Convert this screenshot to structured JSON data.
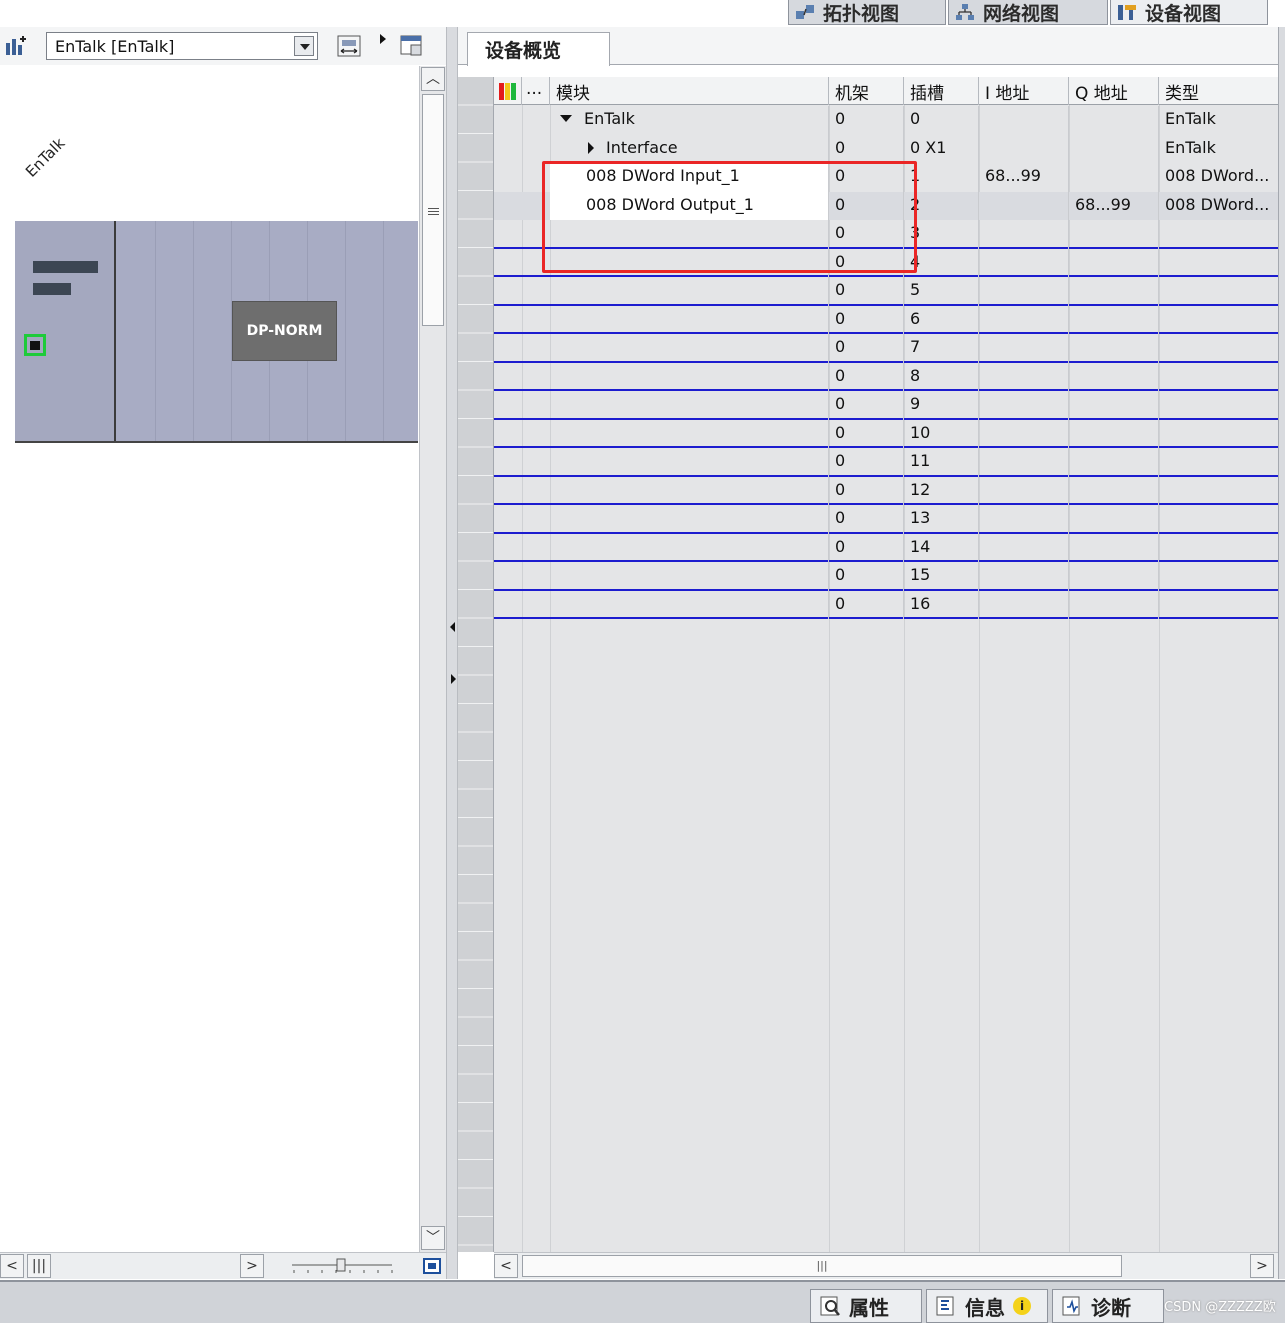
{
  "top_tabs": [
    {
      "label": "拓扑视图",
      "icon": "topology-view-icon"
    },
    {
      "label": "网络视图",
      "icon": "network-view-icon"
    },
    {
      "label": "设备视图",
      "icon": "device-view-icon",
      "active": true
    }
  ],
  "left": {
    "device_select_value": "EnTalk [EnTalk]",
    "rack_label": "EnTalk",
    "module_label": "DP-NORM"
  },
  "overview": {
    "tab_label": "设备概览",
    "columns": {
      "ellipsis": "...",
      "module": "模块",
      "rack": "机架",
      "slot": "插槽",
      "i_addr": "I 地址",
      "q_addr": "Q 地址",
      "type": "类型"
    },
    "rows": [
      {
        "module": "EnTalk",
        "rack": "0",
        "slot": "0",
        "i_addr": "",
        "q_addr": "",
        "type": "EnTalk"
      },
      {
        "module": "Interface",
        "rack": "0",
        "slot": "0 X1",
        "i_addr": "",
        "q_addr": "",
        "type": "EnTalk"
      },
      {
        "module": "008 DWord Input_1",
        "rack": "0",
        "slot": "1",
        "i_addr": "68...99",
        "q_addr": "",
        "type": "008 DWord..."
      },
      {
        "module": "008 DWord Output_1",
        "rack": "0",
        "slot": "2",
        "i_addr": "",
        "q_addr": "68...99",
        "type": "008 DWord..."
      },
      {
        "module": "",
        "rack": "0",
        "slot": "3",
        "i_addr": "",
        "q_addr": "",
        "type": ""
      },
      {
        "module": "",
        "rack": "0",
        "slot": "4",
        "i_addr": "",
        "q_addr": "",
        "type": ""
      },
      {
        "module": "",
        "rack": "0",
        "slot": "5",
        "i_addr": "",
        "q_addr": "",
        "type": ""
      },
      {
        "module": "",
        "rack": "0",
        "slot": "6",
        "i_addr": "",
        "q_addr": "",
        "type": ""
      },
      {
        "module": "",
        "rack": "0",
        "slot": "7",
        "i_addr": "",
        "q_addr": "",
        "type": ""
      },
      {
        "module": "",
        "rack": "0",
        "slot": "8",
        "i_addr": "",
        "q_addr": "",
        "type": ""
      },
      {
        "module": "",
        "rack": "0",
        "slot": "9",
        "i_addr": "",
        "q_addr": "",
        "type": ""
      },
      {
        "module": "",
        "rack": "0",
        "slot": "10",
        "i_addr": "",
        "q_addr": "",
        "type": ""
      },
      {
        "module": "",
        "rack": "0",
        "slot": "11",
        "i_addr": "",
        "q_addr": "",
        "type": ""
      },
      {
        "module": "",
        "rack": "0",
        "slot": "12",
        "i_addr": "",
        "q_addr": "",
        "type": ""
      },
      {
        "module": "",
        "rack": "0",
        "slot": "13",
        "i_addr": "",
        "q_addr": "",
        "type": ""
      },
      {
        "module": "",
        "rack": "0",
        "slot": "14",
        "i_addr": "",
        "q_addr": "",
        "type": ""
      },
      {
        "module": "",
        "rack": "0",
        "slot": "15",
        "i_addr": "",
        "q_addr": "",
        "type": ""
      },
      {
        "module": "",
        "rack": "0",
        "slot": "16",
        "i_addr": "",
        "q_addr": "",
        "type": ""
      }
    ]
  },
  "bottom_tabs": [
    {
      "label": "属性",
      "icon": "properties-icon"
    },
    {
      "label": "信息",
      "icon": "info-icon"
    },
    {
      "label": "诊断",
      "icon": "diagnostics-icon"
    }
  ],
  "watermark": "CSDN @ZZZZZ欧",
  "colors": {
    "highlight_box": "#ea2626",
    "row_separator": "#1c1ccf",
    "status_ok": "#1ecb3a"
  }
}
